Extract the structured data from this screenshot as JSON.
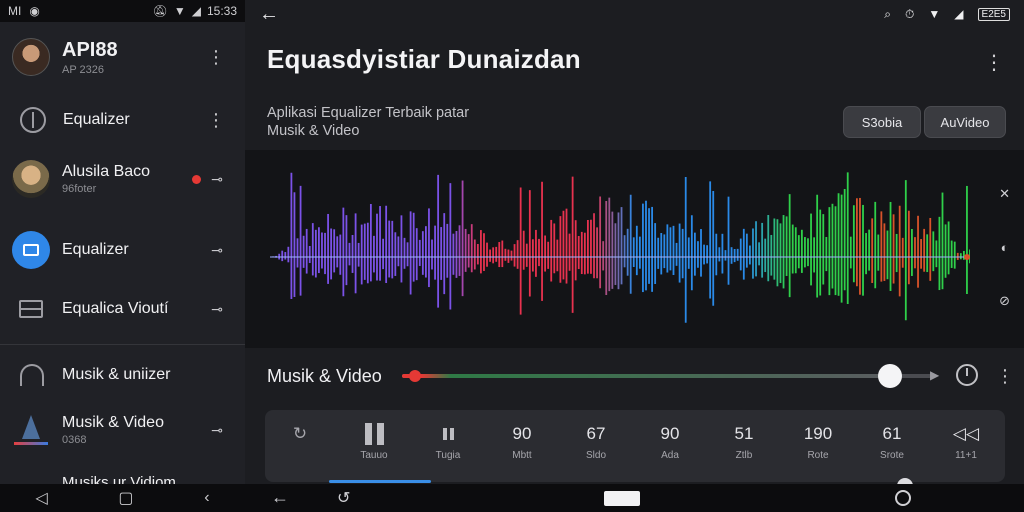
{
  "status_left": {
    "time_text": "15:33",
    "left_label": "MI"
  },
  "sidebar": {
    "profile": {
      "name": "API88",
      "sub": "AP 2326"
    },
    "items": [
      {
        "label": "Equalizer"
      },
      {
        "label": "Alusila Baco",
        "sub": "96foter"
      },
      {
        "label": "Equalizer"
      },
      {
        "label": "Equalica Vioutí"
      },
      {
        "label": "Musik & uniizer"
      },
      {
        "label": "Musik & Video",
        "sub": "0368"
      },
      {
        "label": "Musiks ur Vidiom"
      }
    ]
  },
  "main": {
    "title": "Equasdyistiar Dunaizdan",
    "subtitle_line1": "Aplikasi Equalizer Terbaik patar",
    "subtitle_line2": "Musik & Video",
    "buttons": [
      {
        "label": "S3obia"
      },
      {
        "label": "AuVideo"
      }
    ],
    "status": {
      "battery_text": "E2E5"
    },
    "slider": {
      "label": "Musik & Video",
      "value": 0.92
    },
    "bands": [
      {
        "value": "",
        "label": "",
        "kind": "rotate"
      },
      {
        "value": "",
        "label": "Tauuo",
        "kind": "pause-big"
      },
      {
        "value": "",
        "label": "Tugia",
        "kind": "pause-small"
      },
      {
        "value": "90",
        "label": "Mbtt"
      },
      {
        "value": "67",
        "label": "Sldo"
      },
      {
        "value": "90",
        "label": "Ada"
      },
      {
        "value": "51",
        "label": "Ztlb"
      },
      {
        "value": "190",
        "label": "Rote"
      },
      {
        "value": "61",
        "label": "Srote"
      },
      {
        "value": "◁◁",
        "label": "11+1"
      }
    ]
  },
  "colors": {
    "accent_blue": "#2f87e8",
    "record_red": "#e53935",
    "wave_purple": "#7b52e8",
    "wave_red": "#e8324f",
    "wave_blue": "#2a8ae8",
    "wave_green": "#2fd04a",
    "wave_orange": "#d8532a"
  }
}
